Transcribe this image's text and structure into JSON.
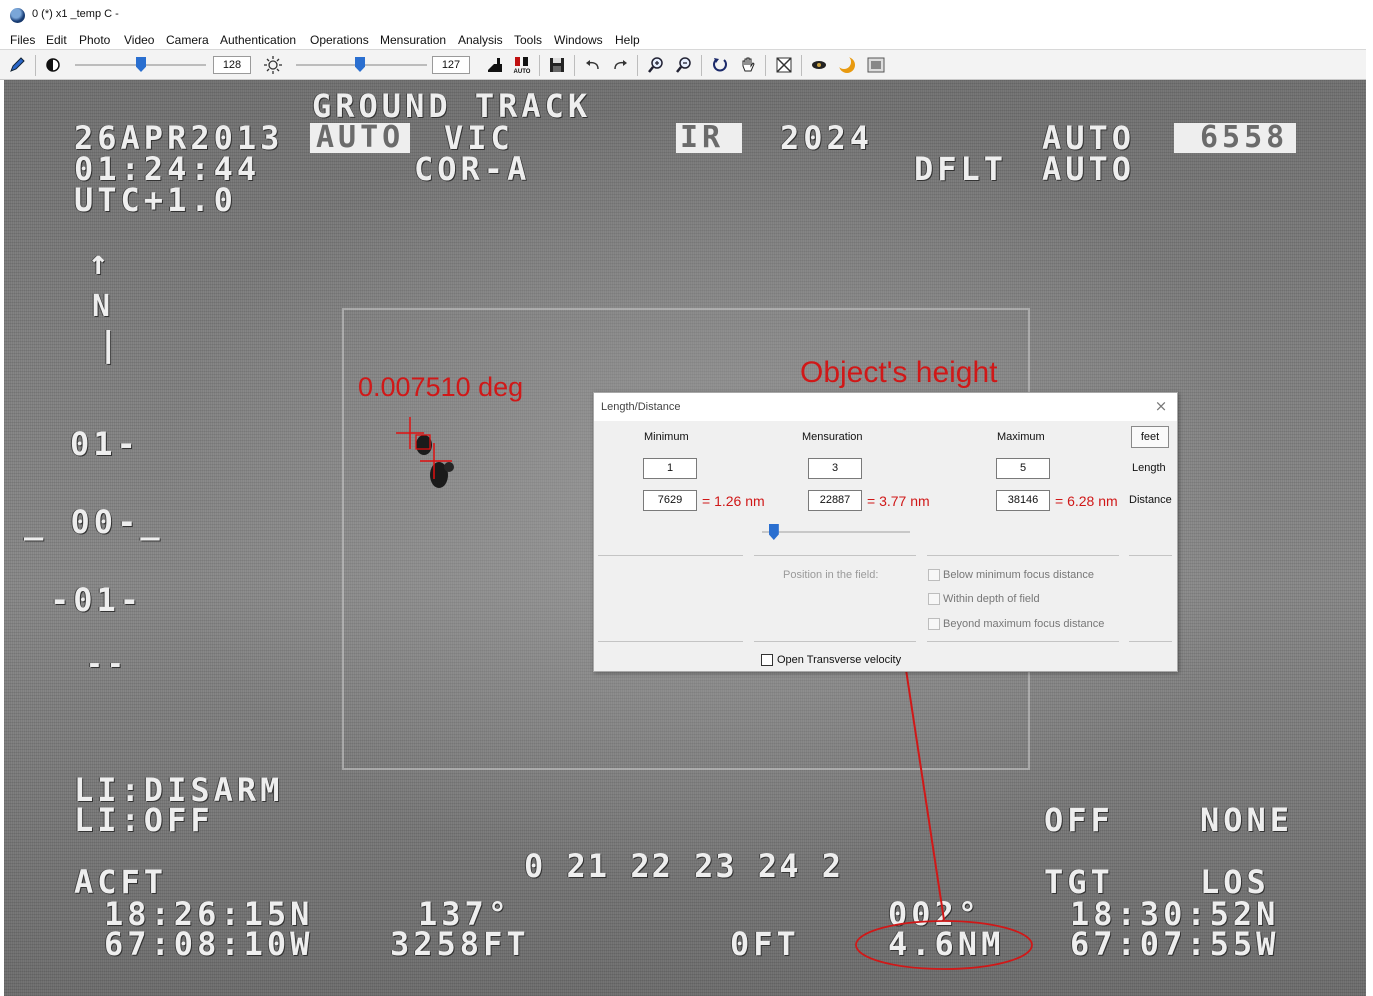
{
  "window": {
    "title": "0 (*) x1 _temp C -"
  },
  "menu": [
    "Files",
    "Edit",
    "Photo",
    "Video",
    "Camera",
    "Authentication",
    "Operations",
    "Mensuration",
    "Analysis",
    "Tools",
    "Windows",
    "Help"
  ],
  "toolbar": {
    "contrast_value": "128",
    "brightness_value": "127",
    "auto_icon_label": "AUTO",
    "icons": [
      "pencil-icon",
      "contrast-icon",
      "brightness-icon",
      "crop-icon",
      "auto-level-icon",
      "save-icon",
      "undo-icon",
      "redo-icon",
      "zoom-in-icon",
      "zoom-out-icon",
      "rotate-icon",
      "pan-hand-icon",
      "fit-icon",
      "eye-icon",
      "moon-icon",
      "gallery-icon"
    ]
  },
  "osd": {
    "mode": "GROUND TRACK",
    "date": "26APR2013",
    "time": "01:24:44",
    "utc": "UTC+1.0",
    "auto_box": "AUTO",
    "vic": "VIC",
    "cor": "COR-A",
    "ir_box": "IR",
    "zoom": "2024",
    "dflt": "DFLT",
    "auto_1": "AUTO",
    "auto_2": "AUTO",
    "box_right": "6558",
    "north_arrow": "↑",
    "north_letter": "N",
    "north_bar": "|",
    "pitch_1": "01-",
    "pitch_0": "_ 00-_",
    "pitch_m1": "-01-",
    "pitch_dash": "--",
    "li_disarm": "LI:DISARM",
    "li_off": "LI:OFF",
    "heading_tape": "0 21 22 23 24 2",
    "off": "OFF",
    "none": "NONE",
    "acft": "ACFT",
    "acft_lat": "18:26:15N",
    "acft_lon": "67:08:10W",
    "heading": "137°",
    "altitude": "3258FT",
    "zero_ft": "0FT",
    "bearing": "002°",
    "range": "4.6NM",
    "tgt": "TGT",
    "los": "LOS",
    "tgt_lat": "18:30:52N",
    "tgt_lon": "67:07:55W"
  },
  "annotations": {
    "angle": "0.007510 deg",
    "object_height": "Object's height",
    "accent": "#d01818"
  },
  "dialog": {
    "title": "Length/Distance",
    "col_min": "Minimum",
    "col_mens": "Mensuration",
    "col_max": "Maximum",
    "unit_button": "feet",
    "length_label": "Length",
    "distance_label": "Distance",
    "min_length": "1",
    "mens_length": "3",
    "max_length": "5",
    "min_distance": "7629",
    "mens_distance": "22887",
    "max_distance": "38146",
    "min_nm": "= 1.26 nm",
    "mens_nm": "= 3.77 nm",
    "max_nm": "= 6.28 nm",
    "slider_level": 0.08,
    "position_label": "Position in the field:",
    "below_min": "Below minimum focus distance",
    "within_dof": "Within depth of field",
    "beyond_max": "Beyond maximum focus distance",
    "transverse": "Open Transverse velocity"
  }
}
